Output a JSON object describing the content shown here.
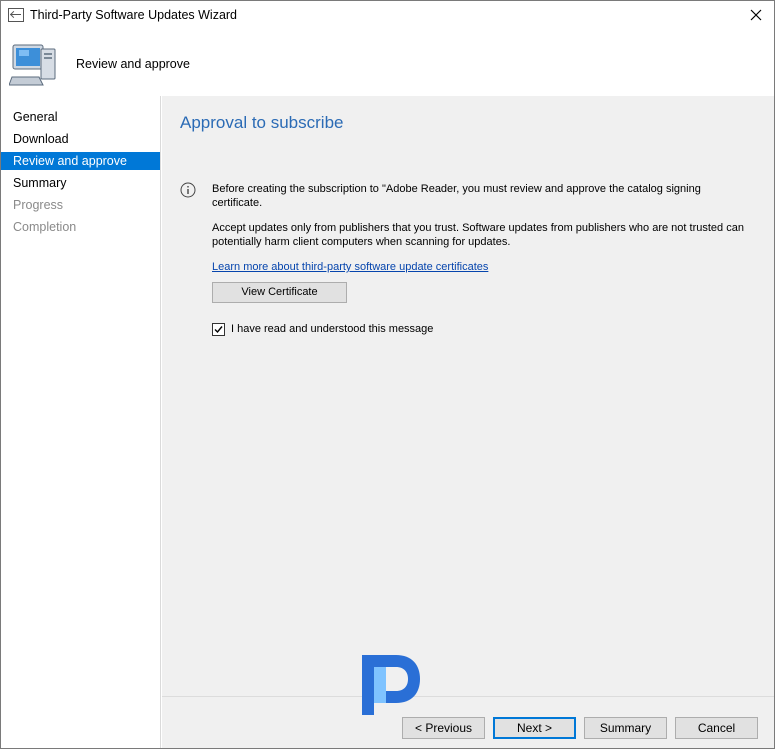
{
  "window": {
    "title": "Third-Party Software Updates Wizard"
  },
  "header": {
    "title": "Review and approve"
  },
  "sidebar": {
    "items": [
      {
        "label": "General",
        "state": "normal"
      },
      {
        "label": "Download",
        "state": "normal"
      },
      {
        "label": "Review and approve",
        "state": "selected"
      },
      {
        "label": "Summary",
        "state": "normal"
      },
      {
        "label": "Progress",
        "state": "disabled"
      },
      {
        "label": "Completion",
        "state": "disabled"
      }
    ]
  },
  "main": {
    "heading": "Approval to subscribe",
    "info_message": "Before creating the subscription to \"Adobe Reader, you must review and approve the catalog signing certificate.",
    "trust_message": "Accept updates only from publishers that you trust. Software updates from publishers who are not trusted can potentially harm client computers when scanning for updates.",
    "learn_more_link": "Learn more about third-party software update certificates",
    "view_certificate_label": "View Certificate",
    "checkbox": {
      "label": "I have read and understood this message",
      "checked": true
    }
  },
  "footer": {
    "previous_label": "< Previous",
    "next_label": "Next >",
    "summary_label": "Summary",
    "cancel_label": "Cancel"
  },
  "colors": {
    "accent": "#0078d7",
    "heading": "#2b6bb5",
    "link": "#0645ad",
    "panel": "#f0f0f0"
  },
  "icons": {
    "title": "wizard-window-icon",
    "header": "computer-icon",
    "close": "close-icon",
    "info": "info-icon",
    "check": "checkmark-icon",
    "logo": "brand-logo-icon"
  }
}
